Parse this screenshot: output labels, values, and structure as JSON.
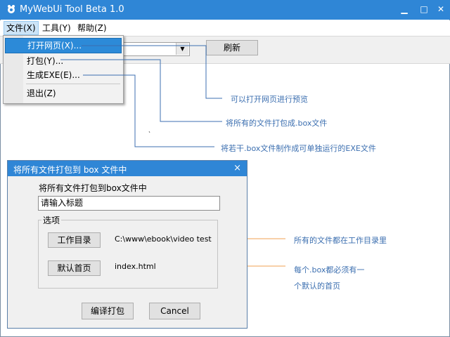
{
  "window": {
    "title": "MyWebUi Tool Beta 1.0",
    "minimize": "▁",
    "maximize": "□",
    "close": "✕"
  },
  "menu": {
    "file": "文件(X)",
    "tools": "工具(Y)",
    "help": "帮助(Z)"
  },
  "toolbar": {
    "refresh": "刷新"
  },
  "file_menu": {
    "open": "打开网页(X)...",
    "pack": "打包(Y)...",
    "exe": "生成EXE(E)...",
    "exit": "退出(Z)"
  },
  "annotations": {
    "open": "可以打开网页进行预览",
    "pack": "将所有的文件打包成.box文件",
    "exe": "将若干.box文件制作成可单独运行的EXE文件",
    "workdir": "所有的文件都在工作目录里",
    "home_1": "每个.box都必须有一",
    "home_2": "个默认的首页"
  },
  "dialog": {
    "title": "将所有文件打包到 box 文件中",
    "close": "×",
    "instruction": "将所有文件打包到box文件中",
    "title_input": "请输入标题",
    "options_label": "选项",
    "workdir_button": "工作目录",
    "workdir_value": "C:\\www\\ebook\\video test",
    "home_button": "默认首页",
    "home_value": "index.html",
    "compile_button": "编译打包",
    "cancel_button": "Cancel"
  }
}
